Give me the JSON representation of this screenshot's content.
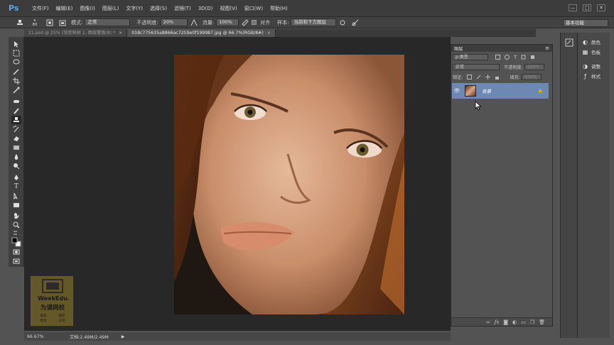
{
  "app": {
    "logo": "Ps",
    "accent": "#5aa7e8"
  },
  "menu": [
    "文件(F)",
    "编辑(E)",
    "图像(I)",
    "图层(L)",
    "文字(Y)",
    "选择(S)",
    "滤镜(T)",
    "3D(D)",
    "视图(V)",
    "窗口(W)",
    "帮助(H)"
  ],
  "window_controls": [
    "—",
    "□",
    "✕"
  ],
  "options": {
    "brush_size": "80",
    "mode_label": "模式:",
    "mode_value": "正常",
    "opacity_label": "不透明度:",
    "opacity_value": "20%",
    "flow_label": "流量:",
    "flow_value": "100%",
    "aligned_label": "对齐",
    "sample_label": "样本:",
    "sample_value": "当前和下方图层",
    "workspace": "基本功能"
  },
  "tabs": [
    {
      "label": "21.psd @ 25% (渐变映射 1, 图层蒙版/8) *",
      "close": "×"
    },
    {
      "label": "018c775635a8866ac7259e0f199987.jpg @ 66.7%(RGB/8#)",
      "close": "×"
    }
  ],
  "status": {
    "zoom": "66.67%",
    "doc": "文档:2.49M/2.49M",
    "arrow": "▶"
  },
  "layers": {
    "title": "图层",
    "filter_value": "ρ 类型",
    "blend_mode": "正常",
    "opacity_label": "不透明度:",
    "opacity_value": "100%",
    "lock_label": "锁定:",
    "fill_label": "填充:",
    "fill_value": "100%",
    "layer_name": "背景"
  },
  "dock": {
    "color": "颜色",
    "swatches": "色板",
    "adjust": "调整",
    "styles": "样式"
  },
  "watermark": {
    "brand": "WeekEdu",
    "domain": ".com",
    "name": "为课网校",
    "notes": [
      "版权",
      "所有",
      "侵权",
      "必究"
    ]
  }
}
